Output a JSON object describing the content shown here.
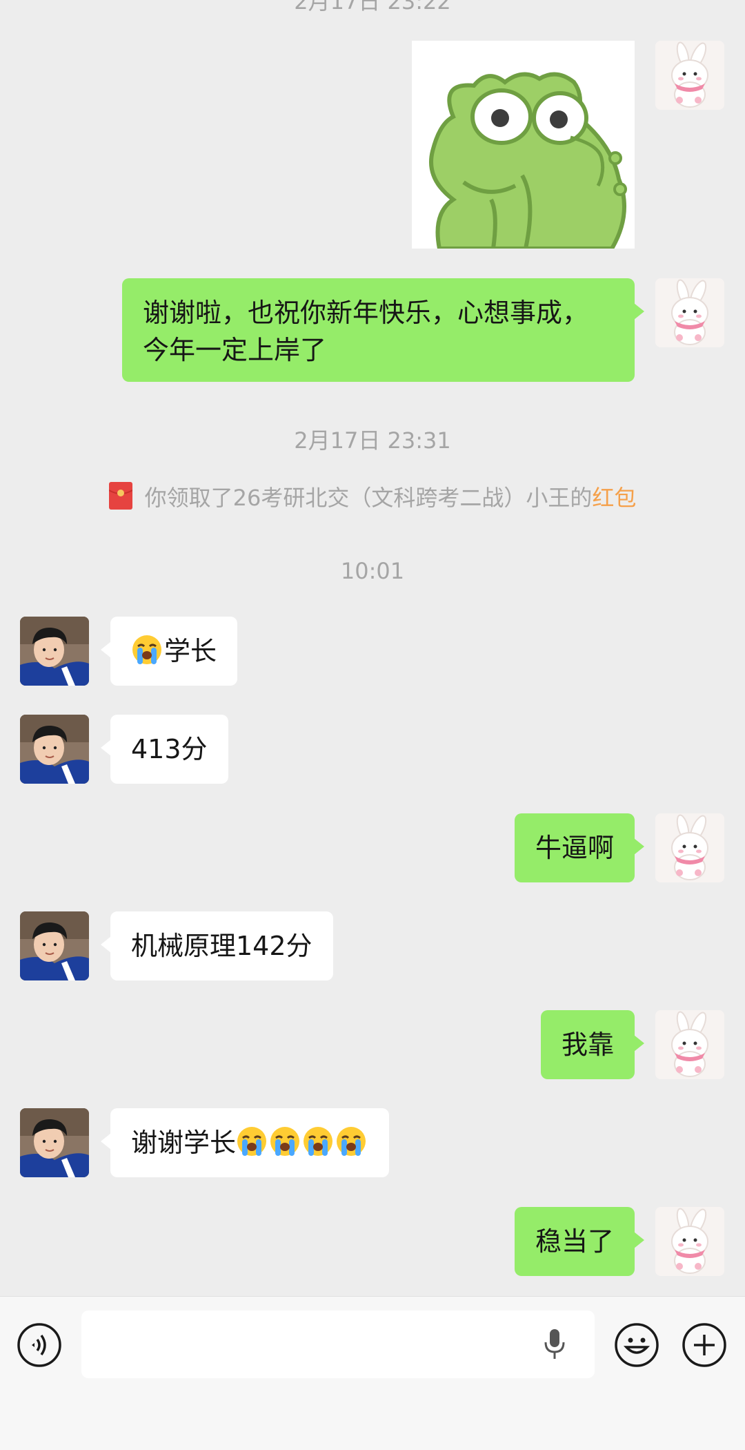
{
  "timestamps": {
    "top_partial": "2月17日 23:22",
    "second": "2月17日 23:31",
    "third": "10:01"
  },
  "system_notice": {
    "prefix": "你领取了",
    "sender": "26考研北交（文科跨考二战）小王的",
    "highlight": "红包"
  },
  "messages": {
    "m1": "谢谢啦，也祝你新年快乐，心想事成，",
    "m1b": "今年一定上岸了",
    "m2": "学长",
    "m3": "413分",
    "m4": "牛逼啊",
    "m5": "机械原理142分",
    "m6": "我靠",
    "m7": "谢谢学长",
    "m8": "稳当了"
  },
  "colors": {
    "my_bubble": "#95ec69",
    "other_bubble": "#ffffff",
    "background": "#ededed",
    "highlight": "#f5a04a"
  },
  "input_bar": {
    "voice_icon": "voice-icon",
    "mic_icon": "microphone-icon",
    "emoji_icon": "emoji-icon",
    "plus_icon": "plus-icon"
  }
}
